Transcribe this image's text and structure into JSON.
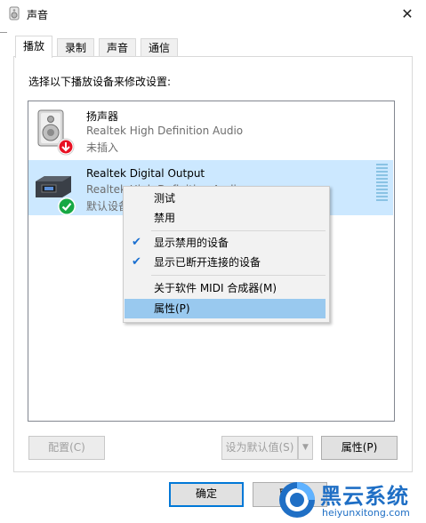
{
  "window": {
    "title": "声音",
    "close_glyph": "✕"
  },
  "tabs": [
    {
      "label": "播放",
      "active": true
    },
    {
      "label": "录制",
      "active": false
    },
    {
      "label": "声音",
      "active": false
    },
    {
      "label": "通信",
      "active": false
    }
  ],
  "instruction": "选择以下播放设备来修改设置:",
  "devices": [
    {
      "name": "扬声器",
      "driver": "Realtek High Definition Audio",
      "status": "未插入",
      "icon": "speaker-icon",
      "badge": "red-down-arrow-icon"
    },
    {
      "name": "Realtek Digital Output",
      "driver": "Realtek High Definition Audio",
      "status": "默认设备",
      "icon": "digital-output-icon",
      "badge": "green-check-icon",
      "selected": true
    }
  ],
  "context_menu": {
    "items": [
      {
        "label": "测试",
        "checked": false
      },
      {
        "label": "禁用",
        "checked": false
      },
      {
        "label": "显示禁用的设备",
        "checked": true
      },
      {
        "label": "显示已断开连接的设备",
        "checked": true
      },
      {
        "label": "关于软件 MIDI 合成器(M)",
        "checked": false
      },
      {
        "label": "属性(P)",
        "checked": false,
        "highlighted": true
      }
    ],
    "check_glyph": "✔"
  },
  "buttons": {
    "configure": "配置(C)",
    "set_default": "设为默认值(S)",
    "properties": "属性(P)",
    "ok": "确定",
    "cancel": "取消"
  },
  "watermark": {
    "brand": "黑云系统",
    "url": "heiyunxitong.com"
  },
  "colors": {
    "accent": "#0078d7",
    "selection": "#cce8ff",
    "menu_highlight": "#99c9ef"
  }
}
